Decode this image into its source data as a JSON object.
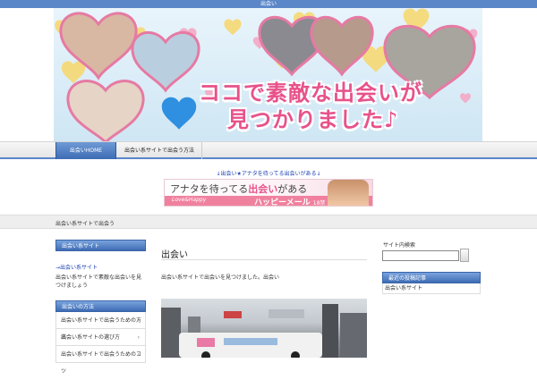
{
  "topbar": {
    "text": "出会い"
  },
  "banner": {
    "headline_line1": "ココで素敵な出会いが",
    "headline_line2": "見つかりました♪"
  },
  "nav": {
    "items": [
      {
        "label": "出会いHOME",
        "active": true
      },
      {
        "label": "出会い系サイトで出会う方法",
        "active": false
      }
    ]
  },
  "promo": {
    "link_text": "↓出会い★アナタを待ってる出会いがある↓",
    "ad_text_prefix": "アナタを待ってる",
    "ad_text_highlight": "出会い",
    "ad_text_suffix": "がある",
    "ad_small": "Love&Happy",
    "ad_brand": "ハッピーメール",
    "ad_age": "18禁"
  },
  "breadcrumb": {
    "text": "出会い系サイトで出会う"
  },
  "left_sidebar": {
    "box1_title": "出会い系サイト",
    "link_text": "→出会い系サイト",
    "description": "出会い系サイトで素敵な出会いを見つけましょう",
    "box2_title": "出会いの方法",
    "list_items": [
      "出会い系サイトで出会うための方法",
      "出会い系サイトの選び方",
      "出会い系サイトで出会うためのコツ"
    ],
    "chevron": "›"
  },
  "main": {
    "title": "出会い",
    "text": "出会い系サイトで出会いを見つけました。出会い"
  },
  "right_sidebar": {
    "search_label": "サイト内検索",
    "box_title": "最近の投稿記事",
    "item_text": "出会い系サイト"
  },
  "colors": {
    "accent_blue": "#5b87c9",
    "headline_pink": "#e8528a",
    "link_blue": "#1a3fb0"
  }
}
